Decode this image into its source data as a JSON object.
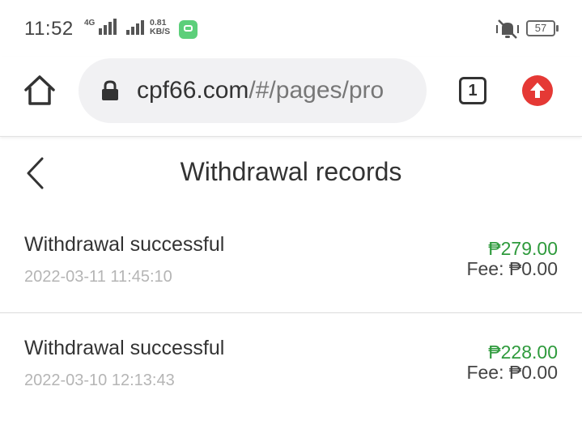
{
  "status_bar": {
    "time": "11:52",
    "network_type": "4G",
    "speed_value": "0.81",
    "speed_unit": "KB/S",
    "battery": "57"
  },
  "browser": {
    "url_main": "cpf66.com",
    "url_rest": "/#/pages/pro",
    "tab_count": "1",
    "icons": [
      "home-icon",
      "lock-icon",
      "tabs-icon",
      "update-arrow-icon"
    ]
  },
  "page": {
    "title": "Withdrawal records",
    "back_icon": "chevron-left-icon"
  },
  "records": [
    {
      "status": "Withdrawal successful",
      "time": "2022-03-11 11:45:10",
      "amount": "₱279.00",
      "fee": "Fee: ₱0.00"
    },
    {
      "status": "Withdrawal successful",
      "time": "2022-03-10 12:13:43",
      "amount": "₱228.00",
      "fee": "Fee: ₱0.00"
    }
  ],
  "colors": {
    "amount_green": "#2e9a3c",
    "update_red": "#e53935",
    "url_bar_bg": "#f1f1f3"
  }
}
